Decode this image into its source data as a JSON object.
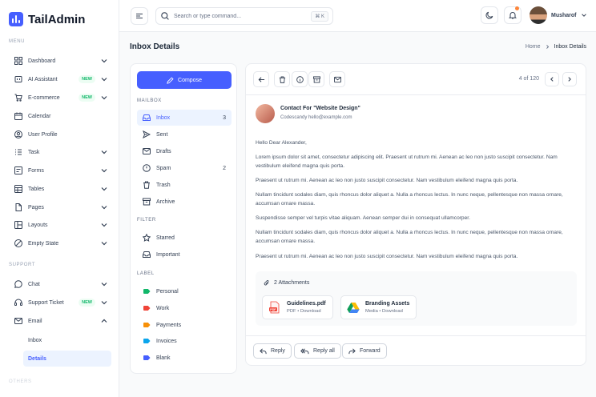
{
  "brand": {
    "name": "TailAdmin",
    "color": "#465fff"
  },
  "sidebar": {
    "menu_title": "MENU",
    "support_title": "SUPPORT",
    "others_title": "OTHERS",
    "items": [
      {
        "label": "Dashboard",
        "icon": "grid-icon",
        "chevron": true
      },
      {
        "label": "AI Assistant",
        "icon": "ai-icon",
        "badge": "NEW",
        "chevron": true
      },
      {
        "label": "E-commerce",
        "icon": "cart-icon",
        "badge": "NEW",
        "chevron": true
      },
      {
        "label": "Calendar",
        "icon": "calendar-icon"
      },
      {
        "label": "User Profile",
        "icon": "user-icon"
      },
      {
        "label": "Task",
        "icon": "task-icon",
        "chevron": true
      },
      {
        "label": "Forms",
        "icon": "forms-icon",
        "chevron": true
      },
      {
        "label": "Tables",
        "icon": "table-icon",
        "chevron": true
      },
      {
        "label": "Pages",
        "icon": "pages-icon",
        "chevron": true
      },
      {
        "label": "Layouts",
        "icon": "layout-icon",
        "chevron": true
      },
      {
        "label": "Empty State",
        "icon": "empty-state-icon",
        "chevron": true
      }
    ],
    "support_items": [
      {
        "label": "Chat",
        "icon": "chat-icon",
        "chevron": true
      },
      {
        "label": "Support Ticket",
        "icon": "headset-icon",
        "badge": "NEW",
        "chevron": true
      },
      {
        "label": "Email",
        "icon": "mail-icon",
        "chevron": true,
        "expanded": true
      }
    ],
    "email_sub": [
      {
        "label": "Inbox"
      },
      {
        "label": "Details",
        "active": true
      }
    ]
  },
  "header": {
    "search_placeholder": "Search or type command...",
    "shortcut": "⌘ K",
    "user_name": "Musharof"
  },
  "page": {
    "title": "Inbox Details",
    "breadcrumb_home": "Home",
    "breadcrumb_current": "Inbox Details"
  },
  "mailbox": {
    "compose_label": "Compose",
    "mailbox_title": "MAILBOX",
    "filter_title": "FILTER",
    "label_title": "LABEL",
    "folders": [
      {
        "label": "Inbox",
        "count": "3",
        "icon": "inbox-icon",
        "active": true
      },
      {
        "label": "Sent",
        "icon": "send-icon"
      },
      {
        "label": "Drafts",
        "icon": "draft-icon"
      },
      {
        "label": "Spam",
        "count": "2",
        "icon": "spam-icon"
      },
      {
        "label": "Trash",
        "icon": "trash-icon"
      },
      {
        "label": "Archive",
        "icon": "archive-icon"
      }
    ],
    "filters": [
      {
        "label": "Starred",
        "icon": "star-icon"
      },
      {
        "label": "Important",
        "icon": "important-icon"
      }
    ],
    "labels": [
      {
        "label": "Personal",
        "color": "#12b76a"
      },
      {
        "label": "Work",
        "color": "#f04438"
      },
      {
        "label": "Payments",
        "color": "#f79009"
      },
      {
        "label": "Invoices",
        "color": "#0ba5ec"
      },
      {
        "label": "Blank",
        "color": "#465fff"
      }
    ]
  },
  "email": {
    "pager": "4 of 120",
    "subject": "Contact For \"Website Design\"",
    "sender": "Codescandy hello@example.com",
    "greeting": "Hello Dear Alexander,",
    "paragraphs": [
      "Lorem ipsum dolor sit amet, consectetur adipiscing elit. Praesent ut rutrum mi. Aenean ac leo non justo suscipit consectetur. Nam vestibulum eleifend magna quis porta.",
      "Praesent ut rutrum mi. Aenean ac leo non justo suscipit consectetur. Nam vestibulum eleifend magna quis porta.",
      "Nullam tincidunt sodales diam, quis rhoncus dolor aliquet a. Nulla a rhoncus lectus. In nunc neque, pellentesque non massa ornare, accumsan ornare massa.",
      "Suspendisse semper vel turpis vitae aliquam. Aenean semper dui in consequat ullamcorper.",
      "Nullam tincidunt sodales diam, quis rhoncus dolor aliquet a. Nulla a rhoncus lectus. In nunc neque, pellentesque non massa ornare, accumsan ornare massa.",
      "Praesent ut rutrum mi. Aenean ac leo non justo suscipit consectetur. Nam vestibulum eleifend magna quis porta."
    ],
    "attachments_title": "2 Attachments",
    "attachments": [
      {
        "name": "Guidelines.pdf",
        "meta": "PDF • Download",
        "icon": "pdf-icon"
      },
      {
        "name": "Branding Assets",
        "meta": "Media • Download",
        "icon": "google-drive-icon"
      }
    ],
    "actions": {
      "reply": "Reply",
      "reply_all": "Reply all",
      "forward": "Forward"
    }
  }
}
